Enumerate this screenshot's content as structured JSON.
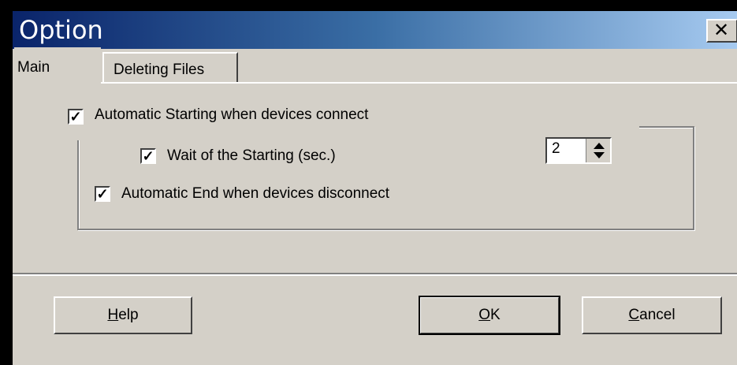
{
  "window": {
    "title": "Option",
    "close_glyph": "✕"
  },
  "tabs": [
    {
      "label": "Main",
      "selected": true
    },
    {
      "label": "Deleting Files",
      "selected": false
    }
  ],
  "main": {
    "auto_start": {
      "label": "Automatic Starting when devices connect",
      "checked": true
    },
    "wait_start": {
      "label": "Wait of the Starting (sec.)",
      "checked": true
    },
    "wait_value": "2",
    "auto_end": {
      "label": "Automatic End when devices disconnect",
      "checked": true
    }
  },
  "buttons": {
    "help": "Help",
    "ok": "OK",
    "cancel": "Cancel"
  },
  "icons": {
    "check": "check-icon",
    "spin_up": "spin-up-icon",
    "spin_down": "spin-down-icon",
    "close": "close-icon"
  }
}
